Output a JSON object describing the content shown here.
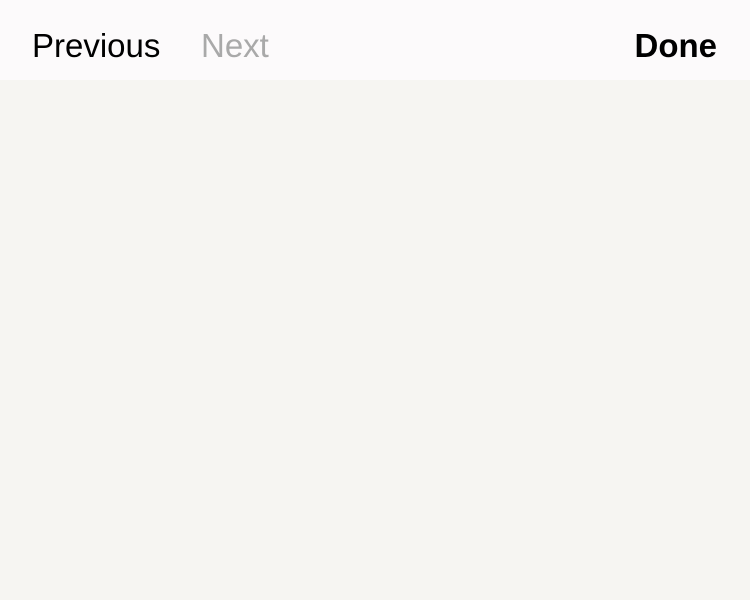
{
  "toolbar": {
    "previous_label": "Previous",
    "next_label": "Next",
    "done_label": "Done",
    "next_enabled": false
  },
  "colors": {
    "toolbar_background": "#fcfafb",
    "content_background": "#f6f5f2",
    "active_text": "#000000",
    "disabled_text": "#a9a9a9"
  }
}
